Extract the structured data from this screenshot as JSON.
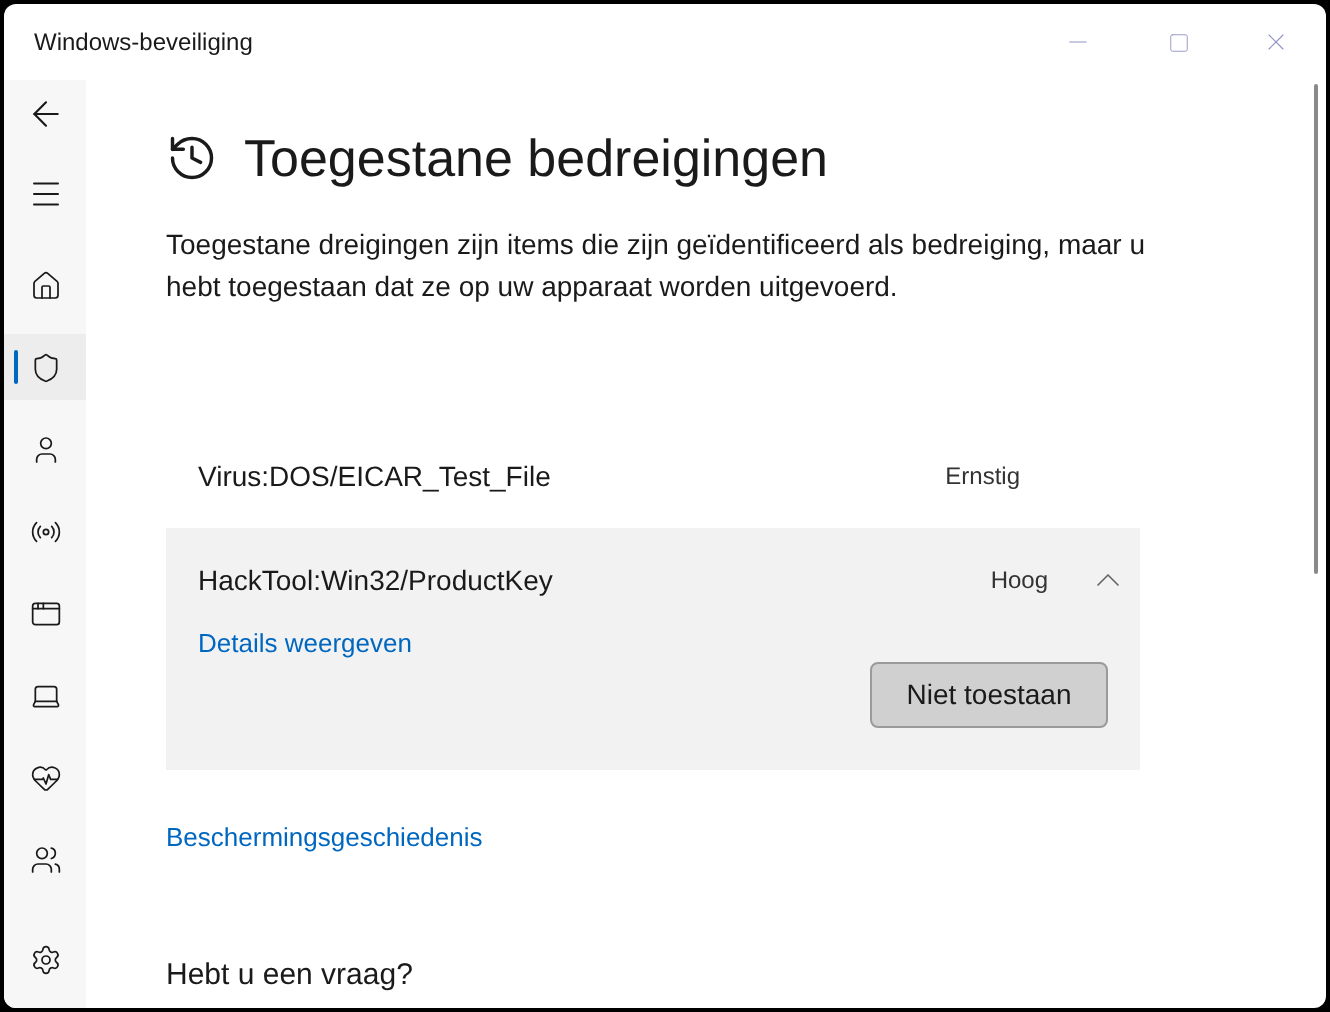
{
  "window": {
    "title": "Windows-beveiliging"
  },
  "sidebar": {
    "items": [
      {
        "kind": "back",
        "selected": false
      },
      {
        "kind": "menu",
        "selected": false
      },
      {
        "kind": "home",
        "selected": false
      },
      {
        "kind": "shield",
        "selected": true
      },
      {
        "kind": "person",
        "selected": false
      },
      {
        "kind": "antenna",
        "selected": false
      },
      {
        "kind": "window",
        "selected": false
      },
      {
        "kind": "laptop",
        "selected": false
      },
      {
        "kind": "heart",
        "selected": false
      },
      {
        "kind": "family",
        "selected": false
      },
      {
        "kind": "settings",
        "selected": false
      }
    ]
  },
  "page": {
    "title": "Toegestane bedreigingen",
    "description": "Toegestane dreigingen zijn items die zijn geïdentificeerd als bedreiging, maar u hebt toegestaan dat ze op uw apparaat worden uitgevoerd."
  },
  "threats": [
    {
      "name": "Virus:DOS/EICAR_Test_File",
      "severity": "Ernstig",
      "expanded": false
    },
    {
      "name": "HackTool:Win32/ProductKey",
      "severity": "Hoog",
      "expanded": true,
      "details_link": "Details weergeven",
      "action": "Niet toestaan"
    }
  ],
  "history_link": "Beschermingsgeschiedenis",
  "question_heading": "Hebt u een vraag?"
}
